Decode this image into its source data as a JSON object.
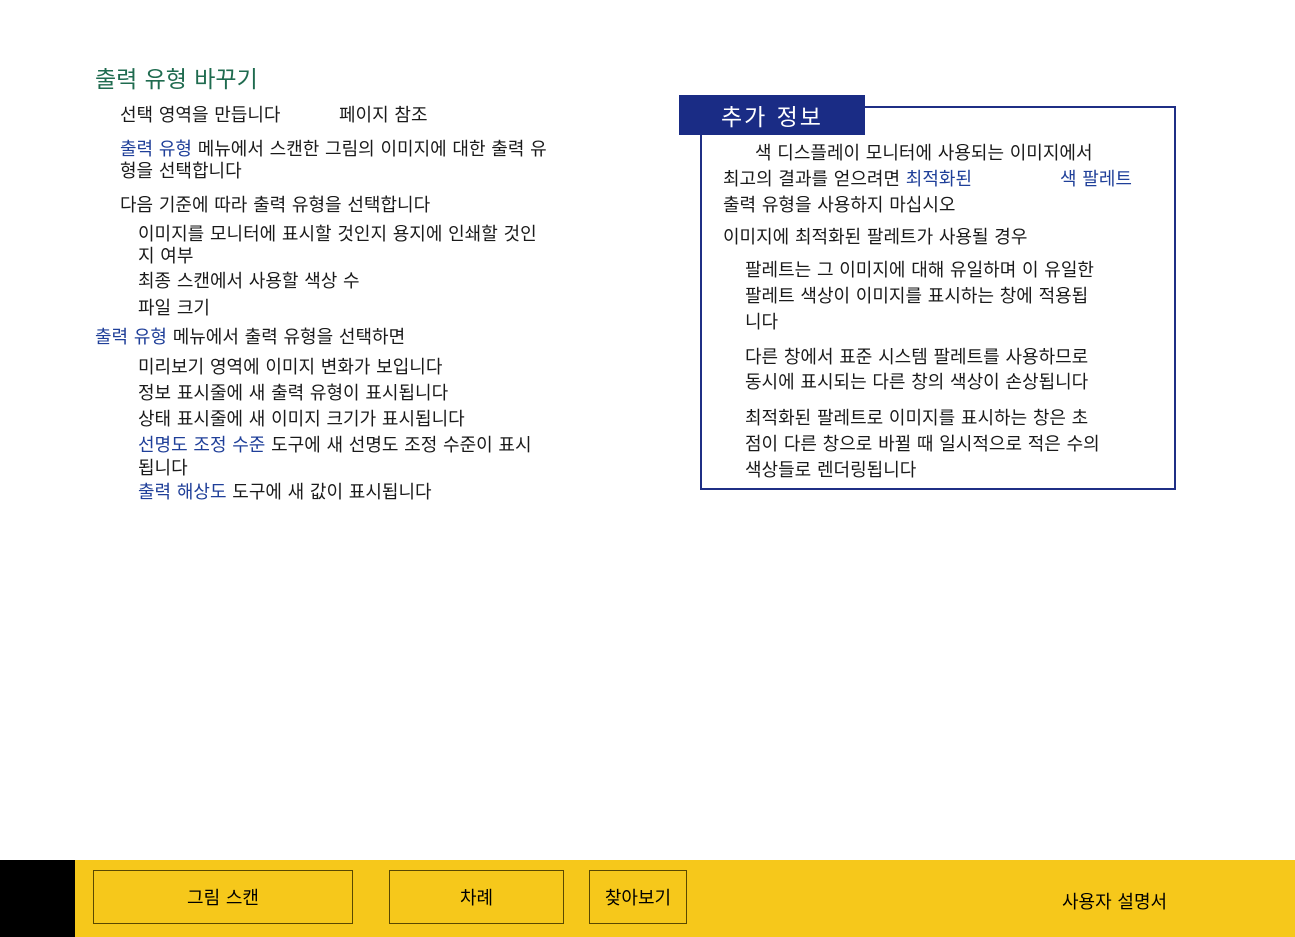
{
  "main": {
    "title": "출력 유형 바꾸기",
    "step1_a": "선택 영역을 만듭니다",
    "step1_b": "페이지 참조",
    "step2_link": "출력 유형",
    "step2_rest": " 메뉴에서 스캔한 그림의 이미지에 대한 출력 유",
    "step2_line2": "형을 선택합니다",
    "step3": "다음 기준에 따라 출력 유형을 선택합니다",
    "crit1_line1": "이미지를  모니터에  표시할  것인지  용지에  인쇄할  것인",
    "crit1_line2": "지 여부",
    "crit2": "최종  스캔에서  사용할  색상 수",
    "crit3": "파일  크기",
    "result_link": "출력  유형",
    "result_rest": " 메뉴에서 출력 유형을 선택하면",
    "res1": "미리보기  영역에  이미지  변화가  보입니다",
    "res2": "정보  표시줄에  새  출력  유형이  표시됩니다",
    "res3": "상태  표시줄에  새  이미지  크기가  표시됩니다",
    "res4_link": "선명도  조정  수준",
    "res4_rest": " 도구에  새 선명도  조정  수준이  표시",
    "res4_line2": "됩니다",
    "res5_link": "출력  해상도",
    "res5_rest": " 도구에  새  값이  표시됩니다"
  },
  "info": {
    "header": "추가 정보",
    "p1_line1": "색 디스플레이 모니터에 사용되는 이미지에서",
    "p1_line2a": "최고의 결과를 얻으려면 ",
    "p1_link1": "최적화된",
    "p1_link2": "색  팔레트",
    "p1_line3": "출력 유형을 사용하지 마십시오",
    "p2": "이미지에 최적화된 팔레트가 사용될 경우",
    "b1_line1": "팔레트는 그 이미지에 대해 유일하며  이 유일한",
    "b1_line2": "팔레트 색상이 이미지를 표시하는 창에 적용됩",
    "b1_line3": "니다",
    "b2_line1": "다른 창에서 표준 시스템 팔레트를 사용하므로",
    "b2_line2": "동시에 표시되는 다른 창의 색상이 손상됩니다",
    "b3_line1": "최적화된 팔레트로 이미지를 표시하는 창은 초",
    "b3_line2": "점이 다른 창으로 바뀔 때 일시적으로 적은 수의",
    "b3_line3": "색상들로 렌더링됩니다"
  },
  "footer": {
    "btn_scan": "그림 스캔",
    "btn_toc": "차례",
    "btn_index": "찾아보기",
    "label": "사용자 설명서"
  },
  "colors": {
    "title": "#1f6b4f",
    "link": "#1f3f99",
    "info_border": "#1f2f85",
    "footer": "#f6c81b"
  }
}
